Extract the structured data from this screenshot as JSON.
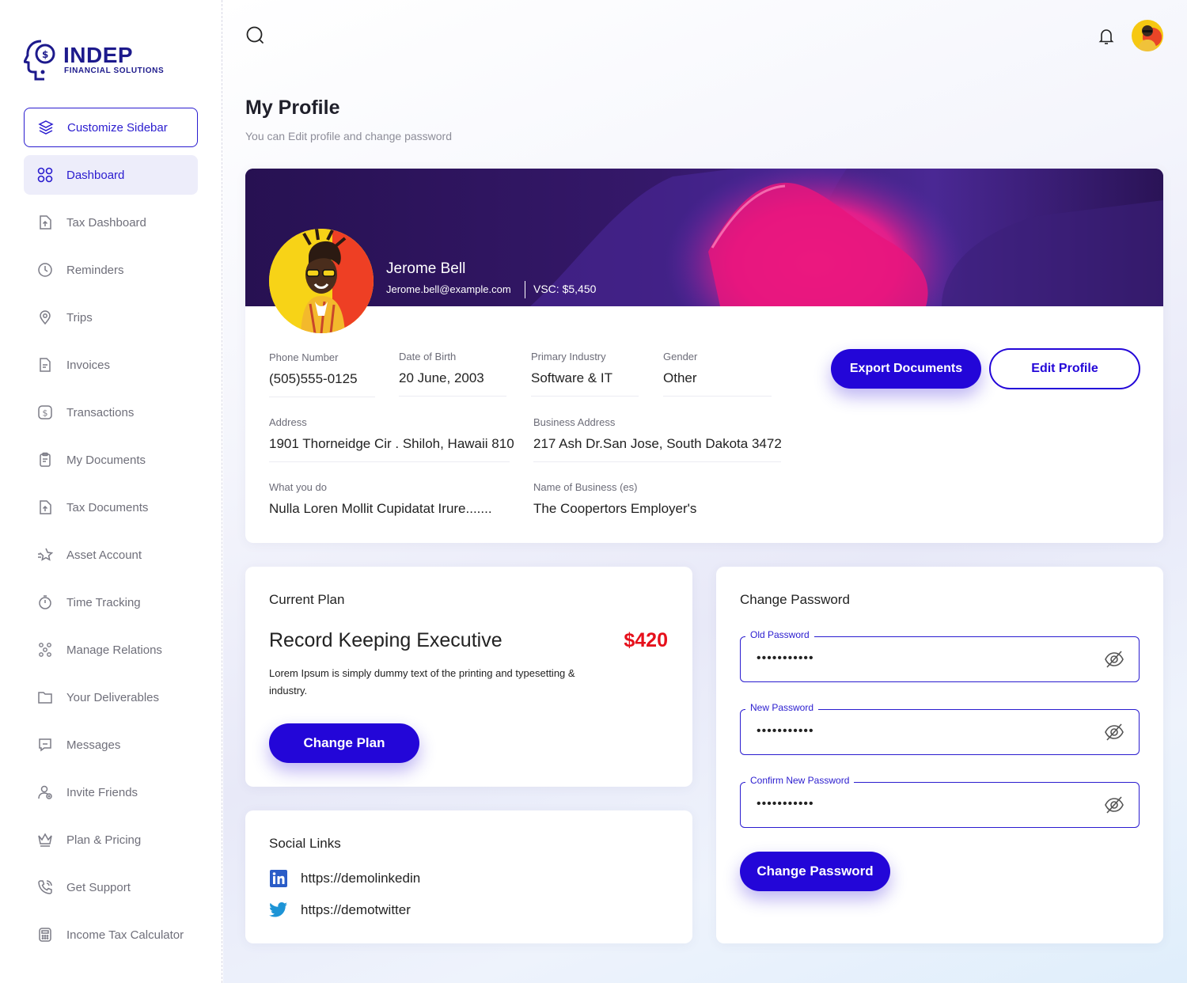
{
  "brand": {
    "name": "INDEP",
    "tagline": "FINANCIAL SOLUTIONS",
    "color": "#1d1a8c"
  },
  "sidebar": {
    "items": [
      {
        "label": "Customize Sidebar",
        "icon": "layers-icon"
      },
      {
        "label": "Dashboard",
        "icon": "grid-icon"
      },
      {
        "label": "Tax Dashboard",
        "icon": "file-upload-icon"
      },
      {
        "label": "Reminders",
        "icon": "clock-icon"
      },
      {
        "label": "Trips",
        "icon": "location-pin-icon"
      },
      {
        "label": "Invoices",
        "icon": "invoice-icon"
      },
      {
        "label": "Transactions",
        "icon": "dollar-icon"
      },
      {
        "label": "My Documents",
        "icon": "clipboard-icon"
      },
      {
        "label": "Tax Documents",
        "icon": "file-upload-icon"
      },
      {
        "label": "Asset Account",
        "icon": "star-icon"
      },
      {
        "label": "Time Tracking",
        "icon": "stopwatch-icon"
      },
      {
        "label": "Manage Relations",
        "icon": "people-network-icon"
      },
      {
        "label": "Your Deliverables",
        "icon": "folder-icon"
      },
      {
        "label": "Messages",
        "icon": "message-icon"
      },
      {
        "label": "Invite Friends",
        "icon": "user-add-icon"
      },
      {
        "label": "Plan & Pricing",
        "icon": "crown-icon"
      },
      {
        "label": "Get Support",
        "icon": "phone-icon"
      },
      {
        "label": "Income Tax Calculator",
        "icon": "calculator-icon"
      }
    ]
  },
  "page": {
    "title": "My Profile",
    "subtitle": "You can Edit profile and change password"
  },
  "profile": {
    "name": "Jerome Bell",
    "email": "Jerome.bell@example.com",
    "vsc": "VSC: $5,450",
    "fields": {
      "phone_label": "Phone Number",
      "phone": "(505)555-0125",
      "dob_label": "Date of Birth",
      "dob": "20 June, 2003",
      "industry_label": "Primary Industry",
      "industry": "Software & IT",
      "gender_label": "Gender",
      "gender": "Other",
      "address_label": "Address",
      "address": "1901 Thorneidge Cir . Shiloh, Hawaii 810",
      "business_address_label": "Business Address",
      "business_address": "217 Ash Dr.San Jose, South Dakota 3472",
      "what_label": "What you do",
      "what": "Nulla Loren Mollit Cupidatat Irure.......",
      "business_name_label": "Name of Business (es)",
      "business_name": "The Coopertors Employer's"
    },
    "export_label": "Export Documents",
    "edit_label": "Edit Profile"
  },
  "plan": {
    "heading": "Current Plan",
    "name": "Record Keeping Executive",
    "price": "$420",
    "description": "Lorem Ipsum is simply dummy text of the printing and typesetting & industry.",
    "button": "Change Plan"
  },
  "social": {
    "heading": "Social Links",
    "links": [
      {
        "icon": "linkedin-icon",
        "url": "https://demolinkedin"
      },
      {
        "icon": "twitter-icon",
        "url": "https://demotwitter"
      }
    ]
  },
  "password": {
    "heading": "Change Password",
    "fields": [
      {
        "label": "Old Password",
        "value": "•••••••••••"
      },
      {
        "label": "New Password",
        "value": "•••••••••••"
      },
      {
        "label": "Confirm New Password",
        "value": "•••••••••••"
      }
    ],
    "button": "Change Password"
  },
  "colors": {
    "accent": "#2306d8",
    "price": "#e6101b",
    "banner": "#2a1250"
  }
}
